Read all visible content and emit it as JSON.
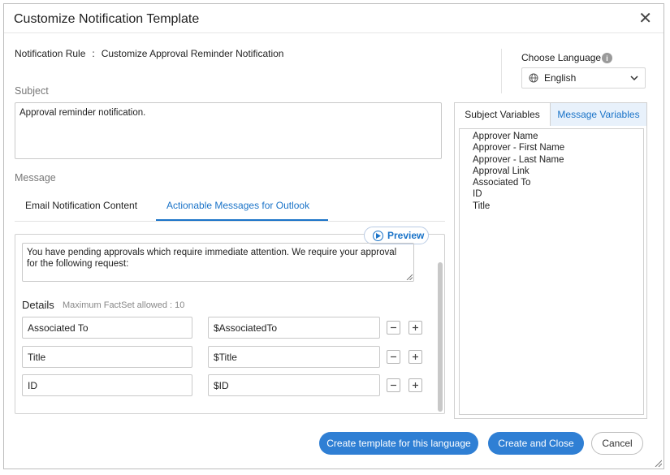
{
  "dialog": {
    "title": "Customize Notification Template",
    "close_glyph": "✕"
  },
  "rule": {
    "label": "Notification Rule",
    "separator": ":",
    "value": "Customize Approval Reminder Notification"
  },
  "subject": {
    "label": "Subject",
    "value": "Approval reminder notification."
  },
  "message": {
    "label": "Message",
    "tabs": [
      {
        "label": "Email Notification Content",
        "active": false
      },
      {
        "label": "Actionable Messages for Outlook",
        "active": true
      }
    ],
    "preview_label": "Preview",
    "body": "You have pending approvals which require immediate attention. We require your approval for the following request:"
  },
  "details": {
    "label": "Details",
    "sublabel": "Maximum FactSet allowed : 10",
    "rows": [
      {
        "name": "Associated To",
        "value": "$AssociatedTo"
      },
      {
        "name": "Title",
        "value": "$Title"
      },
      {
        "name": "ID",
        "value": "$ID"
      }
    ]
  },
  "language": {
    "label": "Choose Language",
    "info_glyph": "i",
    "selected": "English"
  },
  "variables": {
    "tabs": [
      {
        "label": "Subject Variables",
        "active": false
      },
      {
        "label": "Message Variables",
        "active": true
      }
    ],
    "items": [
      "Approver Name",
      "Approver - First Name",
      "Approver - Last Name",
      "Approval Link",
      "Associated To",
      "ID",
      "Title"
    ]
  },
  "footer": {
    "create_template_label": "Create template for this language",
    "create_close_label": "Create and Close",
    "cancel_label": "Cancel"
  },
  "colors": {
    "accent": "#1a73c8",
    "primary_button": "#2f7fd4"
  }
}
